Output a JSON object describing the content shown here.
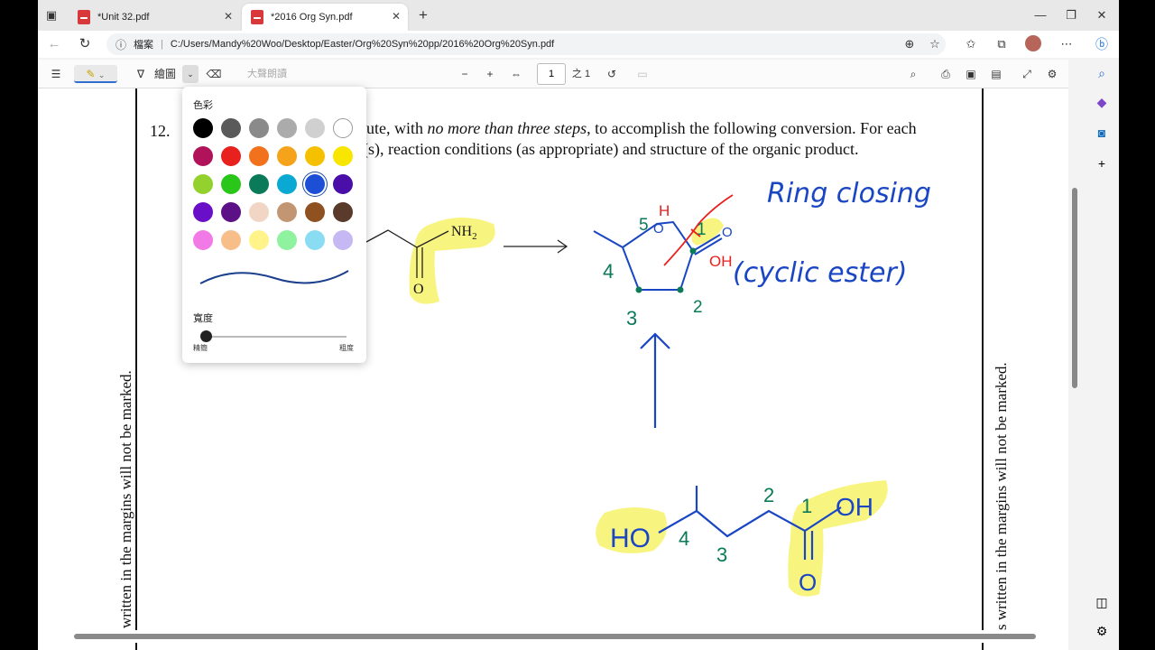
{
  "tabs": [
    {
      "title": "*Unit 32.pdf",
      "active": false
    },
    {
      "title": "*2016 Org Syn.pdf",
      "active": true
    }
  ],
  "address": {
    "info_label": "檔案",
    "url": "C:/Users/Mandy%20Woo/Desktop/Easter/Org%20Syn%20pp/2016%20Org%20Syn.pdf"
  },
  "pdf_toolbar": {
    "draw_label": "繪圖",
    "read_aloud_label": "大聲朗讀",
    "page_number": "1",
    "page_total": "之 1"
  },
  "draw_flyout": {
    "color_heading": "色彩",
    "width_heading": "寬度",
    "thin_label": "精簡",
    "thick_label": "粗度",
    "selected_color": "#1c4fd6",
    "colors": [
      [
        "#000000",
        "#5a5a5a",
        "#8a8a8a",
        "#ababab",
        "#d0d0d0",
        "#ffffff"
      ],
      [
        "#b0135a",
        "#e8201e",
        "#f2711c",
        "#f5a31b",
        "#f5c000",
        "#f8e600"
      ],
      [
        "#92d12e",
        "#2ac71a",
        "#0a7a58",
        "#0aa9d4",
        "#1c4fd6",
        "#4a0fa8"
      ],
      [
        "#6a0fc8",
        "#5c1186",
        "#f2d6c5",
        "#c29672",
        "#8f5120",
        "#5a3a2a"
      ],
      [
        "#f27ae6",
        "#f7be8a",
        "#fff38a",
        "#8ef29e",
        "#8adcf2",
        "#c6b8f2"
      ]
    ]
  },
  "document": {
    "question_number": "12.",
    "line1_prefix": "ute, with ",
    "line1_italic": "no more than three steps",
    "line1_suffix": ", to accomplish the following conversion.  For each",
    "line2": "(s), reaction conditions (as appropriate) and structure of the organic product.",
    "margin_note_left": "written in the margins will not be marked.",
    "margin_note_right": "s written in the margins will not be marked.",
    "nh2_label": "NH",
    "nh2_sub": "2",
    "o_label": "O",
    "ring_o_label": "O",
    "ring_co_label": "O",
    "annotations": {
      "ring_closing": "Ring closing",
      "cyclic_ester": "(cyclic ester)",
      "h_label": "H",
      "oh_red": "OH",
      "ho_label": "HO",
      "oh_label": "OH",
      "o_bottom": "O",
      "n1": "1",
      "n2": "2",
      "n3": "3",
      "n4": "4",
      "n5": "5",
      "b1": "1",
      "b2": "2",
      "b3": "3",
      "b4": "4"
    }
  },
  "colors": {
    "ink_blue": "#1a46c4",
    "ink_green": "#0a7a58",
    "ink_red": "#e8201e",
    "highlight": "#f7f26a"
  }
}
